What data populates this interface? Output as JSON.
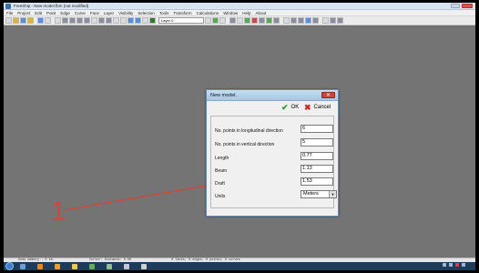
{
  "window": {
    "title": "FreeShip - New model.fbm (not modified)"
  },
  "menubar": {
    "items": [
      "File",
      "Project",
      "Edit",
      "Point",
      "Edge",
      "Curve",
      "Face",
      "Layer",
      "Visibility",
      "Selection",
      "Tools",
      "Transform",
      "Calculations",
      "Window",
      "Help",
      "About"
    ]
  },
  "toolbar": {
    "layer_value": "Layer 0"
  },
  "dialog": {
    "title": "New model.",
    "ok_label": "OK",
    "cancel_label": "Cancel",
    "fields": [
      {
        "label": "No. points in longitudinal direction",
        "value": "6"
      },
      {
        "label": "No. points in vertical direction",
        "value": "5"
      },
      {
        "label": "Length",
        "value": "0.77"
      },
      {
        "label": "Beam",
        "value": "1.13"
      },
      {
        "label": "Draft",
        "value": "1.53"
      }
    ],
    "units": {
      "label": "Units",
      "value": "Meters"
    }
  },
  "annotation": {
    "number": "1",
    "color": "#d8443a"
  },
  "statusbar": {
    "memory": "Undo memory : 0 kb.",
    "distance": "Cursor: Distance: 0.00",
    "counts": "0 faces, 0 edges, 0 points, 0 curves"
  },
  "icons": [
    "freeship-app-icon",
    "windows-start-orb",
    "ok-check-icon",
    "cancel-x-icon",
    "dropdown-arrow-icon"
  ]
}
